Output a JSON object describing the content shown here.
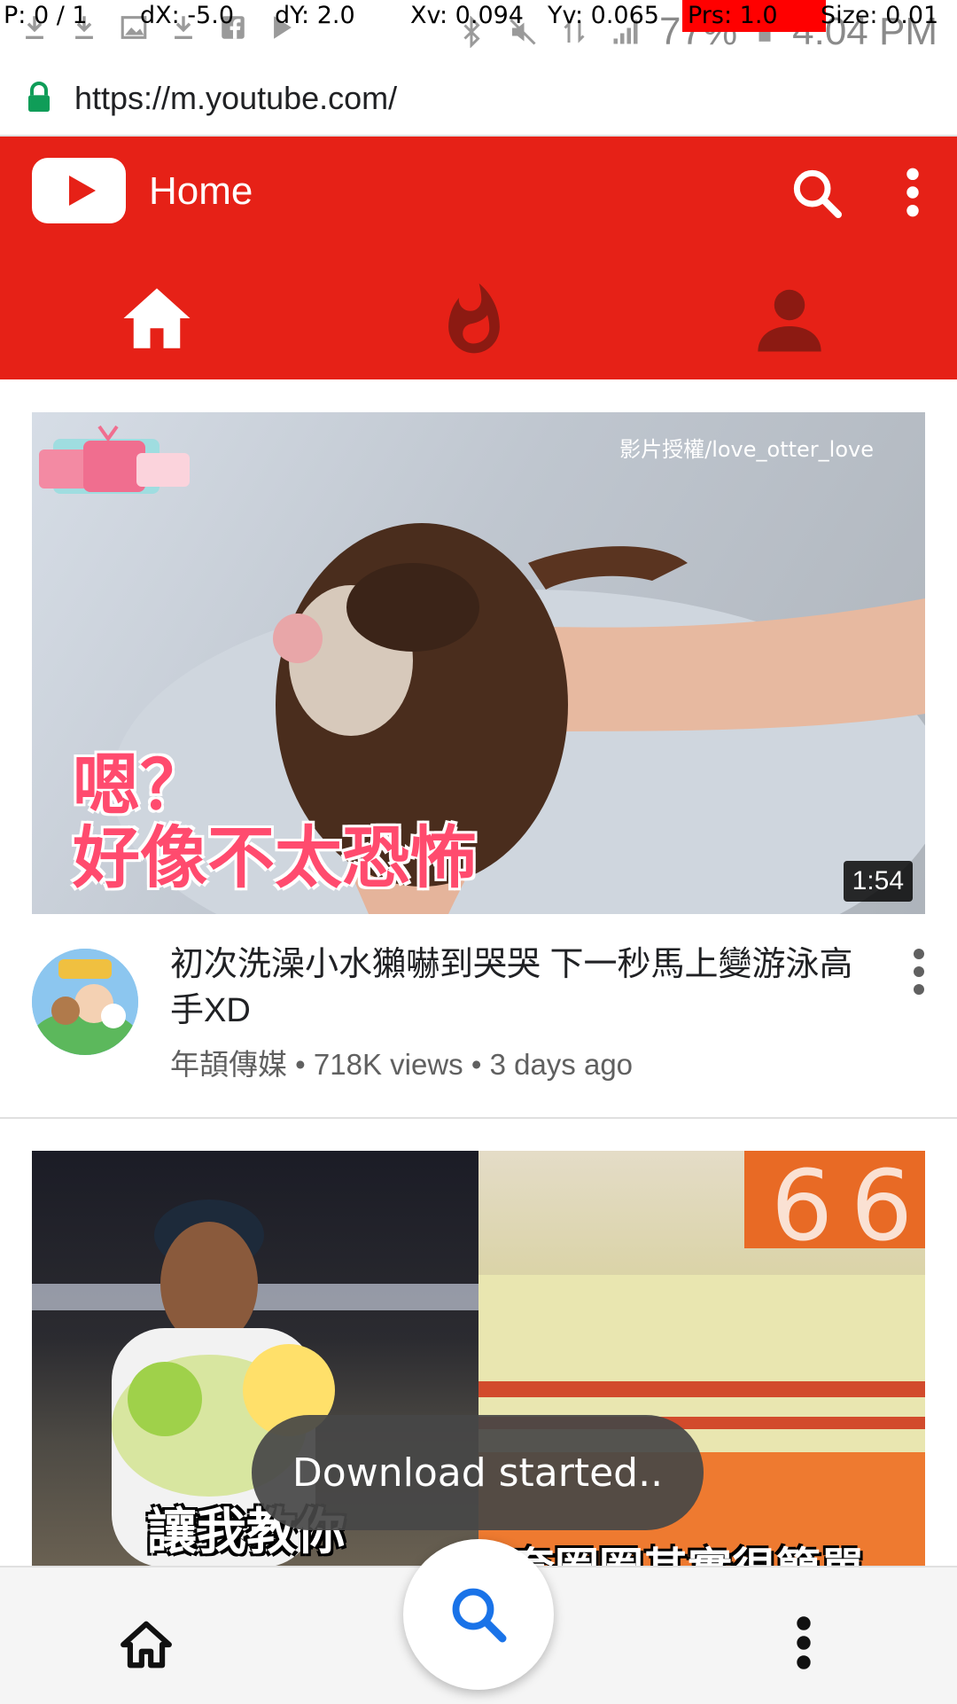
{
  "debug_overlay": {
    "pointer": "P: 0 / 1",
    "dx": "dX: -5.0",
    "dy": "dY: 2.0",
    "xv": "Xv: 0.094",
    "yv": "Yv: 0.065",
    "prs": "Prs: 1.0",
    "size": "Size: 0.01"
  },
  "status_bar": {
    "battery": "77%",
    "time": "4:04 PM"
  },
  "browser": {
    "url": "https://m.youtube.com/"
  },
  "header": {
    "title": "Home",
    "tabs": [
      {
        "name": "home",
        "active": true
      },
      {
        "name": "trending",
        "active": false
      },
      {
        "name": "account",
        "active": false
      }
    ]
  },
  "videos": [
    {
      "title": "初次洗澡小水獺嚇到哭哭 下一秒馬上變游泳高手XD",
      "channel": "年頡傳媒",
      "views": "718K views",
      "age": "3 days ago",
      "duration": "1:54",
      "thumbnail_text": {
        "watermark": "影片授權/love_otter_love",
        "caption_line1": "嗯？",
        "caption_line2": "好像不太恐怖"
      }
    },
    {
      "thumbnail_text": {
        "caption_left": "讓我教你",
        "caption_right": "套圈圈其實很簡單"
      }
    }
  ],
  "toast": "Download started..",
  "colors": {
    "youtube_red": "#e62117",
    "active_tab": "#ffffff",
    "inactive_tab": "#8c1a12",
    "fab_icon": "#1a73e8"
  }
}
